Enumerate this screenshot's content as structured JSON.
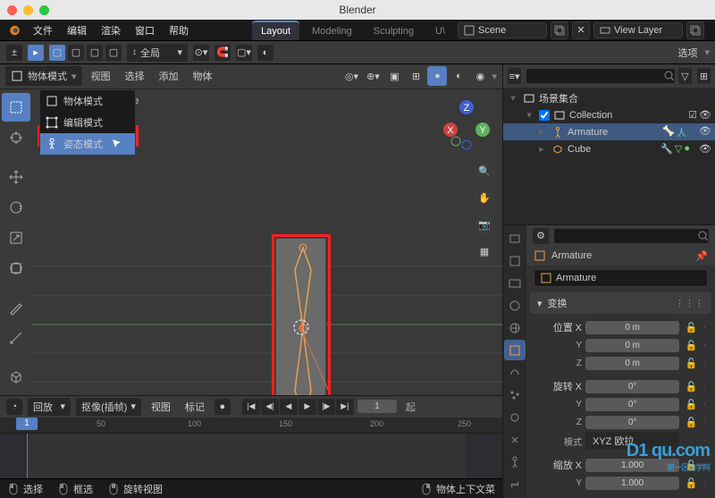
{
  "window": {
    "title": "Blender"
  },
  "topmenu": {
    "file": "文件",
    "edit": "编辑",
    "render": "渲染",
    "window": "窗口",
    "help": "帮助"
  },
  "workspaces": {
    "layout": "Layout",
    "modeling": "Modeling",
    "sculpting": "Sculpting",
    "uv": "U\\"
  },
  "scene_bar": {
    "scene_label": "Scene",
    "layer_label": "View Layer"
  },
  "viewport_hdr": {
    "mode": "物体模式",
    "pivot": "全局",
    "view": "视图",
    "select": "选择",
    "add": "添加",
    "object": "物体",
    "options": "选项"
  },
  "mode_dropdown": {
    "object": "物体模式",
    "edit": "编辑模式",
    "pose": "姿态模式"
  },
  "overlay": {
    "info": "tion | Armature"
  },
  "timeline": {
    "playback": "回放",
    "keying": "抠像(插帧)",
    "view": "视图",
    "marker": "标记",
    "frame": "1",
    "start": "起",
    "ticks": [
      "50",
      "100",
      "150",
      "200",
      "250"
    ]
  },
  "statusbar": {
    "select": "选择",
    "box": "框选",
    "rotate": "旋转视图",
    "context": "物体上下文菜"
  },
  "outliner": {
    "scene": "场景集合",
    "collection": "Collection",
    "armature": "Armature",
    "cube": "Cube",
    "search_ph": ""
  },
  "props": {
    "breadcrumb": "Armature",
    "name": "Armature",
    "panel_transform": "变换",
    "pos": "位置",
    "rot": "旋转",
    "scale": "缩放",
    "mode_label": "模式",
    "mode_val": "XYZ 欧拉",
    "x": "X",
    "y": "Y",
    "z": "Z",
    "zero_m": "0 m",
    "zero_deg": "0°",
    "one": "1.000"
  }
}
